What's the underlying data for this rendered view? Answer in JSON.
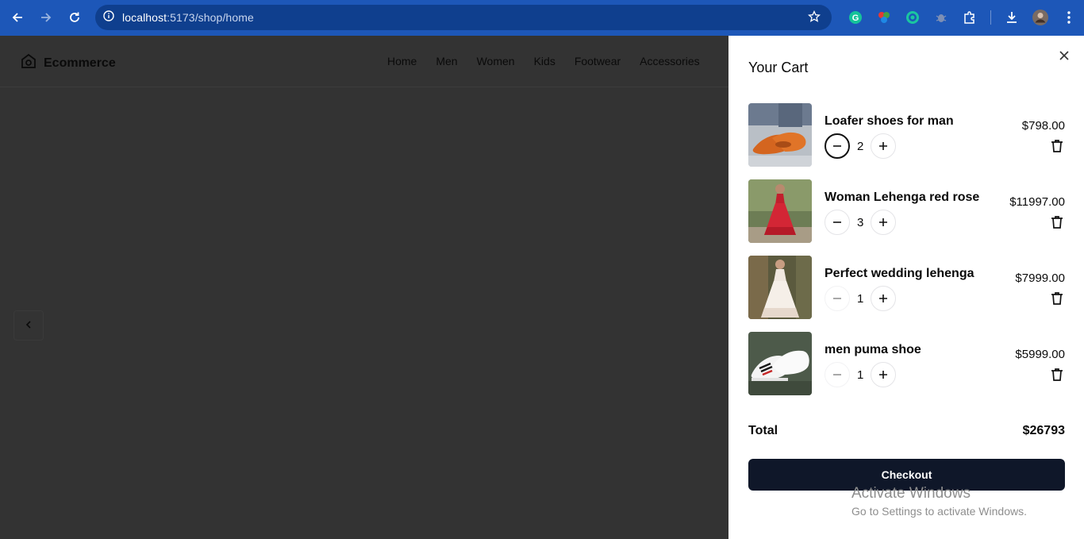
{
  "browser": {
    "url_host": "localhost",
    "url_path": ":5173/shop/home"
  },
  "header": {
    "brand": "Ecommerce",
    "nav": [
      "Home",
      "Men",
      "Women",
      "Kids",
      "Footwear",
      "Accessories"
    ]
  },
  "cart": {
    "title": "Your Cart",
    "items": [
      {
        "title": "Loafer shoes for man",
        "quantity": "2",
        "price": "$798.00"
      },
      {
        "title": "Woman Lehenga red rose",
        "quantity": "3",
        "price": "$11997.00"
      },
      {
        "title": "Perfect wedding lehenga",
        "quantity": "1",
        "price": "$7999.00"
      },
      {
        "title": "men puma shoe",
        "quantity": "1",
        "price": "$5999.00"
      }
    ],
    "total_label": "Total",
    "total_value": "$26793",
    "checkout_label": "Checkout"
  },
  "os_watermark": {
    "line1": "Activate Windows",
    "line2": "Go to Settings to activate Windows."
  },
  "colors": {
    "browser_bar": "#1d57b8",
    "overlay": "#333333",
    "checkout_bg": "#0f1729"
  }
}
